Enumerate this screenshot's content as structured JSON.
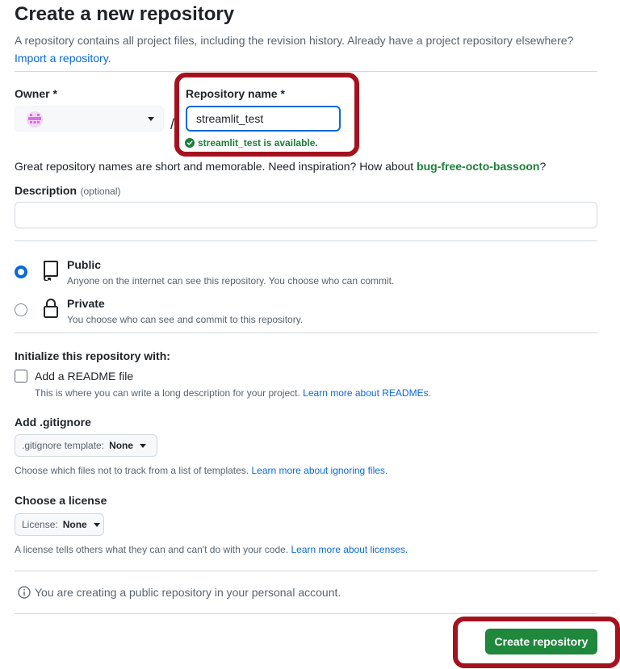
{
  "page": {
    "title": "Create a new repository",
    "intro_text": "A repository contains all project files, including the revision history. Already have a project repository elsewhere?",
    "import_link": "Import a repository."
  },
  "owner": {
    "label": "Owner *",
    "avatar_icon": "identicon-avatar",
    "value": ""
  },
  "repo_name": {
    "label": "Repository name *",
    "value": "streamlit_test",
    "availability": "streamlit_test is available.",
    "status_color": "#1a7f37"
  },
  "separator": "/",
  "naming_hint": {
    "text": "Great repository names are short and memorable. Need inspiration? How about ",
    "suggestion": "bug-free-octo-bassoon",
    "suffix": "?"
  },
  "description": {
    "label": "Description",
    "optional": "(optional)",
    "value": ""
  },
  "visibility": {
    "selected": "public",
    "options": [
      {
        "id": "public",
        "icon": "repo-icon",
        "title": "Public",
        "subtitle": "Anyone on the internet can see this repository. You choose who can commit."
      },
      {
        "id": "private",
        "icon": "lock-icon",
        "title": "Private",
        "subtitle": "You choose who can see and commit to this repository."
      }
    ]
  },
  "initialize": {
    "heading": "Initialize this repository with:",
    "readme_label": "Add a README file",
    "readme_checked": false,
    "readme_help": "This is where you can write a long description for your project.",
    "readme_link": "Learn more about READMEs."
  },
  "gitignore": {
    "heading": "Add .gitignore",
    "select_prefix": ".gitignore template:",
    "select_value": "None",
    "help": "Choose which files not to track from a list of templates.",
    "help_link": "Learn more about ignoring files."
  },
  "license": {
    "heading": "Choose a license",
    "select_prefix": "License:",
    "select_value": "None",
    "help": "A license tells others what they can and can't do with your code.",
    "help_link": "Learn more about licenses."
  },
  "notice": {
    "icon": "info-icon",
    "text": "You are creating a public repository in your personal account."
  },
  "submit": {
    "label": "Create repository",
    "color": "#1f883d"
  },
  "annotation_color": "#a5121e"
}
